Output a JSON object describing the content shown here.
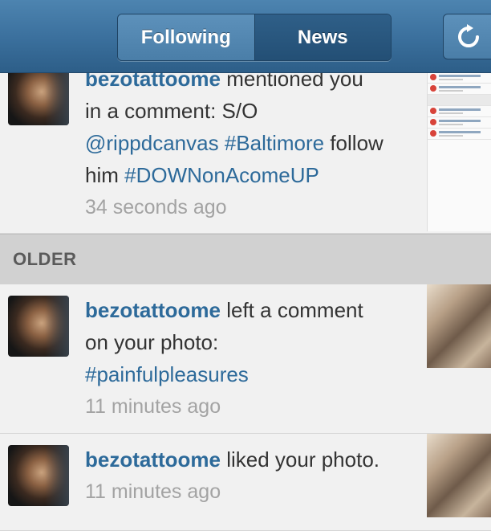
{
  "nav": {
    "tabs": [
      {
        "label": "Following"
      },
      {
        "label": "News"
      }
    ],
    "refresh_icon": "refresh-icon"
  },
  "rows": [
    {
      "user": "bezotattoome",
      "line1_rest": " mentioned you",
      "line2": "in a comment: S/O",
      "mention": "@rippdcanvas",
      "hashtag1": "#Baltimore",
      "follow": " follow",
      "line4_prefix": "him ",
      "hashtag2": "#DOWNonAcomeUP",
      "time": "34 seconds ago"
    }
  ],
  "section": {
    "label": "OLDER"
  },
  "older": [
    {
      "user": "bezotattoome",
      "rest": " left a comment",
      "line2": "on your photo:",
      "hashtag": "#painfulpleasures",
      "time": "11 minutes ago"
    },
    {
      "user": "bezotattoome",
      "rest": " liked your photo.",
      "time": "11 minutes ago"
    }
  ],
  "colors": {
    "nav": "#3a6f9c",
    "link": "#2d6a9a",
    "time": "#a3a3a3"
  }
}
